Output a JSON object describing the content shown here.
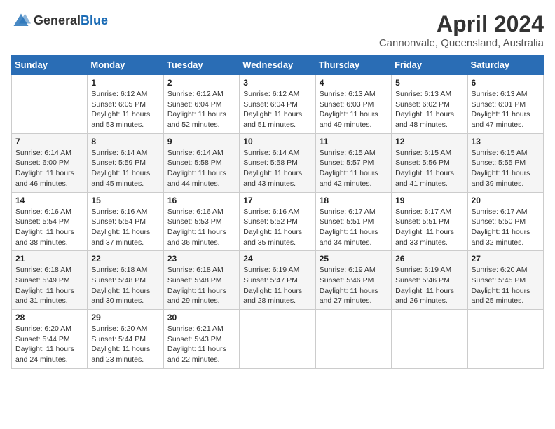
{
  "header": {
    "logo_general": "General",
    "logo_blue": "Blue",
    "month": "April 2024",
    "location": "Cannonvale, Queensland, Australia"
  },
  "days_of_week": [
    "Sunday",
    "Monday",
    "Tuesday",
    "Wednesday",
    "Thursday",
    "Friday",
    "Saturday"
  ],
  "weeks": [
    [
      {
        "day": "",
        "info": ""
      },
      {
        "day": "1",
        "info": "Sunrise: 6:12 AM\nSunset: 6:05 PM\nDaylight: 11 hours\nand 53 minutes."
      },
      {
        "day": "2",
        "info": "Sunrise: 6:12 AM\nSunset: 6:04 PM\nDaylight: 11 hours\nand 52 minutes."
      },
      {
        "day": "3",
        "info": "Sunrise: 6:12 AM\nSunset: 6:04 PM\nDaylight: 11 hours\nand 51 minutes."
      },
      {
        "day": "4",
        "info": "Sunrise: 6:13 AM\nSunset: 6:03 PM\nDaylight: 11 hours\nand 49 minutes."
      },
      {
        "day": "5",
        "info": "Sunrise: 6:13 AM\nSunset: 6:02 PM\nDaylight: 11 hours\nand 48 minutes."
      },
      {
        "day": "6",
        "info": "Sunrise: 6:13 AM\nSunset: 6:01 PM\nDaylight: 11 hours\nand 47 minutes."
      }
    ],
    [
      {
        "day": "7",
        "info": "Sunrise: 6:14 AM\nSunset: 6:00 PM\nDaylight: 11 hours\nand 46 minutes."
      },
      {
        "day": "8",
        "info": "Sunrise: 6:14 AM\nSunset: 5:59 PM\nDaylight: 11 hours\nand 45 minutes."
      },
      {
        "day": "9",
        "info": "Sunrise: 6:14 AM\nSunset: 5:58 PM\nDaylight: 11 hours\nand 44 minutes."
      },
      {
        "day": "10",
        "info": "Sunrise: 6:14 AM\nSunset: 5:58 PM\nDaylight: 11 hours\nand 43 minutes."
      },
      {
        "day": "11",
        "info": "Sunrise: 6:15 AM\nSunset: 5:57 PM\nDaylight: 11 hours\nand 42 minutes."
      },
      {
        "day": "12",
        "info": "Sunrise: 6:15 AM\nSunset: 5:56 PM\nDaylight: 11 hours\nand 41 minutes."
      },
      {
        "day": "13",
        "info": "Sunrise: 6:15 AM\nSunset: 5:55 PM\nDaylight: 11 hours\nand 39 minutes."
      }
    ],
    [
      {
        "day": "14",
        "info": "Sunrise: 6:16 AM\nSunset: 5:54 PM\nDaylight: 11 hours\nand 38 minutes."
      },
      {
        "day": "15",
        "info": "Sunrise: 6:16 AM\nSunset: 5:54 PM\nDaylight: 11 hours\nand 37 minutes."
      },
      {
        "day": "16",
        "info": "Sunrise: 6:16 AM\nSunset: 5:53 PM\nDaylight: 11 hours\nand 36 minutes."
      },
      {
        "day": "17",
        "info": "Sunrise: 6:16 AM\nSunset: 5:52 PM\nDaylight: 11 hours\nand 35 minutes."
      },
      {
        "day": "18",
        "info": "Sunrise: 6:17 AM\nSunset: 5:51 PM\nDaylight: 11 hours\nand 34 minutes."
      },
      {
        "day": "19",
        "info": "Sunrise: 6:17 AM\nSunset: 5:51 PM\nDaylight: 11 hours\nand 33 minutes."
      },
      {
        "day": "20",
        "info": "Sunrise: 6:17 AM\nSunset: 5:50 PM\nDaylight: 11 hours\nand 32 minutes."
      }
    ],
    [
      {
        "day": "21",
        "info": "Sunrise: 6:18 AM\nSunset: 5:49 PM\nDaylight: 11 hours\nand 31 minutes."
      },
      {
        "day": "22",
        "info": "Sunrise: 6:18 AM\nSunset: 5:48 PM\nDaylight: 11 hours\nand 30 minutes."
      },
      {
        "day": "23",
        "info": "Sunrise: 6:18 AM\nSunset: 5:48 PM\nDaylight: 11 hours\nand 29 minutes."
      },
      {
        "day": "24",
        "info": "Sunrise: 6:19 AM\nSunset: 5:47 PM\nDaylight: 11 hours\nand 28 minutes."
      },
      {
        "day": "25",
        "info": "Sunrise: 6:19 AM\nSunset: 5:46 PM\nDaylight: 11 hours\nand 27 minutes."
      },
      {
        "day": "26",
        "info": "Sunrise: 6:19 AM\nSunset: 5:46 PM\nDaylight: 11 hours\nand 26 minutes."
      },
      {
        "day": "27",
        "info": "Sunrise: 6:20 AM\nSunset: 5:45 PM\nDaylight: 11 hours\nand 25 minutes."
      }
    ],
    [
      {
        "day": "28",
        "info": "Sunrise: 6:20 AM\nSunset: 5:44 PM\nDaylight: 11 hours\nand 24 minutes."
      },
      {
        "day": "29",
        "info": "Sunrise: 6:20 AM\nSunset: 5:44 PM\nDaylight: 11 hours\nand 23 minutes."
      },
      {
        "day": "30",
        "info": "Sunrise: 6:21 AM\nSunset: 5:43 PM\nDaylight: 11 hours\nand 22 minutes."
      },
      {
        "day": "",
        "info": ""
      },
      {
        "day": "",
        "info": ""
      },
      {
        "day": "",
        "info": ""
      },
      {
        "day": "",
        "info": ""
      }
    ]
  ]
}
